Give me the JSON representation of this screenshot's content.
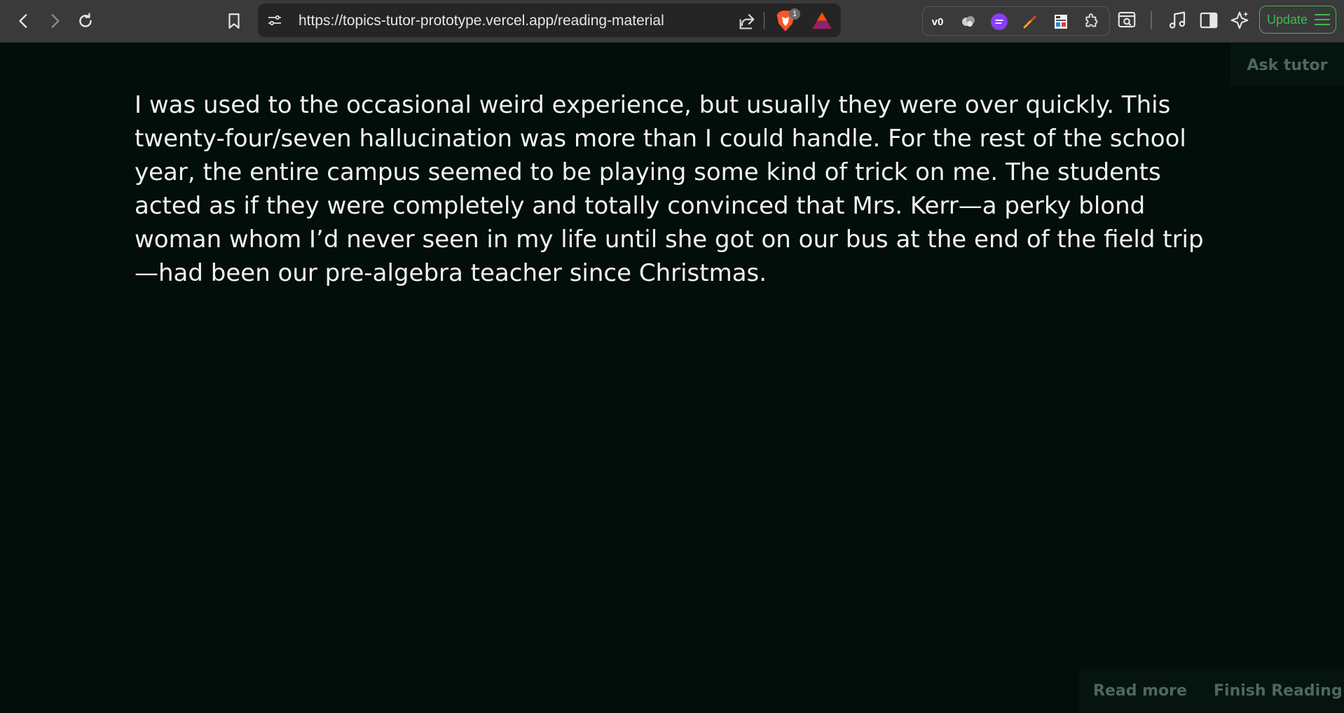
{
  "browser": {
    "url": "https://topics-tutor-prototype.vercel.app/reading-material",
    "shields_badge": "1",
    "update_label": "Update",
    "nav_icons": [
      "back-icon",
      "forward-icon",
      "reload-icon",
      "bookmark-icon"
    ],
    "extension_icons": [
      "v0-extension-icon",
      "cloud-extension-icon",
      "web-to-figma-extension-icon",
      "color-picker-extension-icon",
      "page-extension-icon",
      "puzzle-extensions-icon",
      "screenshot-search-icon"
    ],
    "toolbar_icons": [
      "media-icon",
      "sidebar-icon",
      "leo-ai-icon",
      "menu-icon"
    ]
  },
  "page": {
    "ask_tutor_label": "Ask tutor",
    "passage": "I was used to the occasional weird experience, but usually they were over quickly. This twenty-four/seven hallucination was more than I could handle. For the rest of the school year, the entire campus seemed to be playing some kind of trick on me. The students acted as if they were completely and totally convinced that Mrs. Kerr—a perky blond woman whom I’d never seen in my life until she got on our bus at the end of the field trip—had been our pre-algebra teacher since Christmas.",
    "read_more_label": "Read more",
    "finish_reading_label": "Finish Reading"
  },
  "colors": {
    "page_bg": "#020e0a",
    "text": "#f2f2f2",
    "muted_button": "#4e6760",
    "update_green": "#3fb950"
  }
}
